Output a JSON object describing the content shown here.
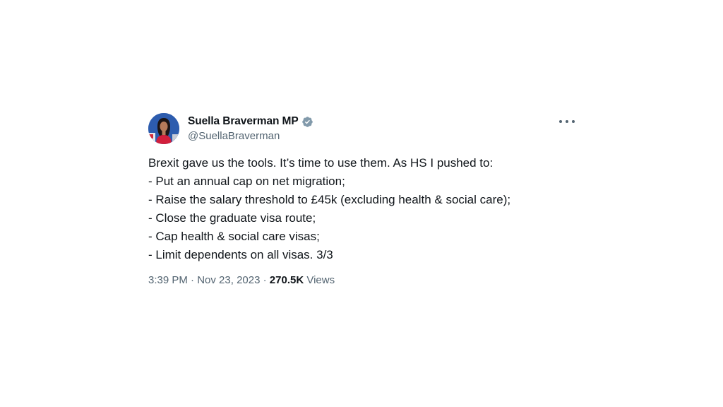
{
  "tweet": {
    "author": {
      "display_name": "Suella Braverman MP",
      "handle": "@SuellaBraverman",
      "verified": true,
      "verified_badge_color": "#829aab",
      "avatar_icon": "profile-photo"
    },
    "more_icon": "more-horizontal-icon",
    "body_lines": [
      "Brexit gave us the tools. It’s time to use them. As HS I pushed to:",
      "- Put an annual cap on net migration;",
      "- Raise the salary threshold to £45k (excluding health & social care);",
      "- Close the graduate visa route;",
      "- Cap health & social care visas;",
      "- Limit dependents on all visas. 3/3"
    ],
    "meta": {
      "time": "3:39 PM",
      "separator": "·",
      "date": "Nov 23, 2023",
      "views_count": "270.5K",
      "views_label": "Views"
    }
  },
  "colors": {
    "text_primary": "#0f1419",
    "text_secondary": "#536471",
    "background": "#ffffff"
  }
}
